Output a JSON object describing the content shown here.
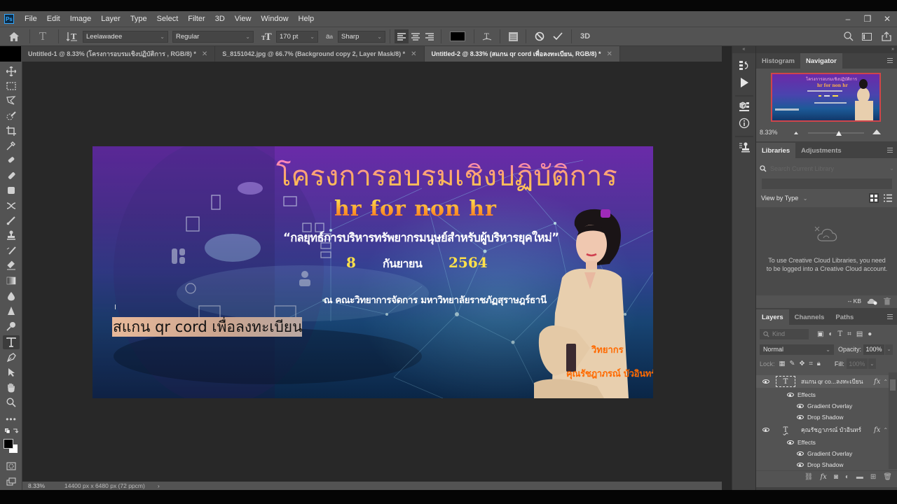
{
  "app": {
    "name": "Adobe Photoshop",
    "logo": "Ps",
    "menu": [
      "File",
      "Edit",
      "Image",
      "Layer",
      "Type",
      "Select",
      "Filter",
      "3D",
      "View",
      "Window",
      "Help"
    ],
    "window_controls": {
      "minimize": "–",
      "restore": "❐",
      "close": "✕"
    }
  },
  "options_bar": {
    "font_family": "Leelawadee",
    "font_style": "Regular",
    "font_size": "170 pt",
    "anti_alias": "Sharp",
    "alignment": "left",
    "text_color": "#000000",
    "three_d_label": "3D"
  },
  "tabs": [
    {
      "label": "Untitled-1 @ 8.33% (โครงการอบรมเชิงปฏิบัติการ , RGB/8) *",
      "active": false
    },
    {
      "label": "S_8151042.jpg @ 66.7% (Background copy 2, Layer Mask/8) *",
      "active": false
    },
    {
      "label": "Untitled-2 @ 8.33% (สแกน qr cord เพื่อลงทะเบียน, RGB/8) *",
      "active": true
    }
  ],
  "tools": [
    "move",
    "marquee",
    "lasso",
    "quick-select",
    "crop",
    "eyedropper",
    "healing-brush",
    "brush",
    "clone-stamp",
    "history-brush",
    "eraser",
    "gradient",
    "blur",
    "dodge",
    "pen",
    "type",
    "path-select",
    "shape",
    "hand",
    "zoom",
    "more",
    "color-swatches"
  ],
  "active_tool": "type",
  "colors": {
    "foreground": "#000000",
    "background": "#ffffff"
  },
  "artboard": {
    "title": "โครงการอบรมเชิงปฏิบัติการ",
    "subtitle": "hr for non hr",
    "quote": "“กลยุทธ์การบริหารทรัพยากรมนุษย์สำหรับผู้บริหารยุคใหม่”",
    "date_day": "8",
    "date_month": "กันยายน",
    "date_year": "2564",
    "venue": "ณ คณะวิทยาการจัดการ มหาวิทยาลัยราชภัฏสุราษฎร์ธานี",
    "qr_text": "สแกน qr cord เพื่อลงทะเบียน",
    "speaker_role": "วิทยากร",
    "speaker_name": "คุณรัชฎาภรณ์ บัวอินทร์"
  },
  "status_bar": {
    "zoom": "8.33%",
    "doc_info": "14400 px x 6480 px (72 ppcm)",
    "arrow": "›"
  },
  "navigator_panel": {
    "tabs": [
      "Histogram",
      "Navigator"
    ],
    "active_tab": "Navigator",
    "zoom": "8.33%",
    "zoom_slider_fraction": 0.55
  },
  "libraries_panel": {
    "tabs": [
      "Libraries",
      "Adjustments"
    ],
    "active_tab": "Libraries",
    "search_placeholder": "Search Current Library",
    "view_by": "View by Type",
    "message": "To use Creative Cloud Libraries, you need to be logged into a Creative Cloud account.",
    "size": "-- KB"
  },
  "layers_panel": {
    "tabs": [
      "Layers",
      "Channels",
      "Paths"
    ],
    "active_tab": "Layers",
    "kind_placeholder": "Kind",
    "blend_mode": "Normal",
    "opacity_label": "Opacity:",
    "opacity": "100%",
    "lock_label": "Lock:",
    "fill_label": "Fill:",
    "fill": "100%",
    "layers": [
      {
        "name": "สแกน qr co...ลงทะเบียน",
        "type": "text",
        "selected": true,
        "effects_label": "Effects",
        "effects": [
          "Gradient Overlay",
          "Drop Shadow"
        ]
      },
      {
        "name": "คุณรัชฎาภรณ์ บัวอินทร์",
        "type": "warped-text",
        "selected": false,
        "effects_label": "Effects",
        "effects": [
          "Gradient Overlay",
          "Drop Shadow"
        ]
      }
    ]
  }
}
